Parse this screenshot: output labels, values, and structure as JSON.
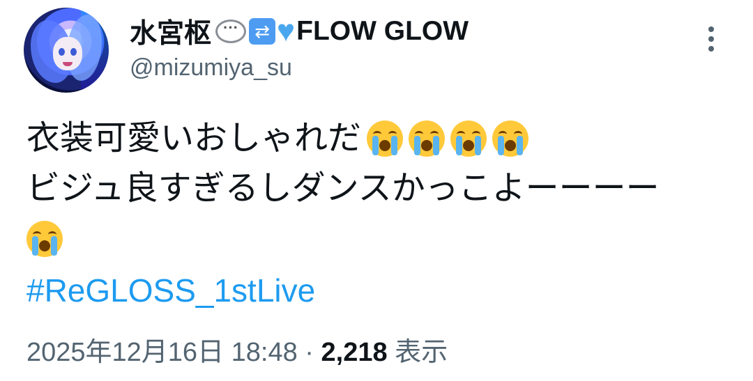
{
  "author": {
    "display_name": "水宮枢",
    "display_name_suffix": "FLOW GLOW",
    "name_icons": [
      "speech-bubble-icon",
      "repeat-icon",
      "blue-heart-icon"
    ],
    "handle": "@mizumiya_su"
  },
  "tweet": {
    "line1": "衣装可愛いおしゃれだ",
    "line2": "ビジュ良すぎるしダンスかっこよーーーー",
    "emoji": "loudly-crying-face-icon",
    "hashtag": "#ReGLOSS_1stLive"
  },
  "meta": {
    "timestamp": "2025年12月16日 18:48",
    "separator": "·",
    "views_count": "2,218",
    "views_label": "表示"
  },
  "colors": {
    "text": "#0f1419",
    "secondary": "#536471",
    "link": "#1d9bf0"
  }
}
